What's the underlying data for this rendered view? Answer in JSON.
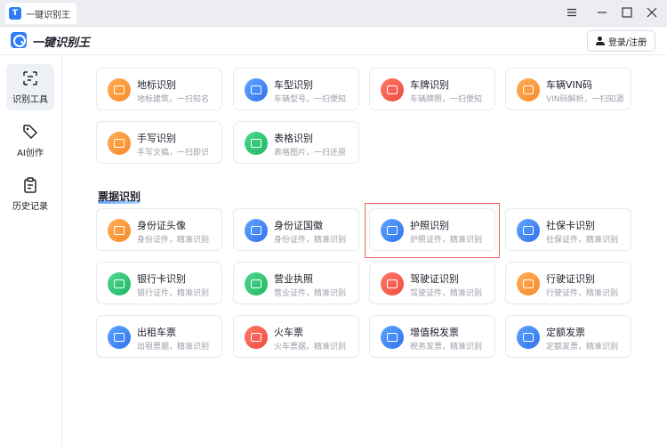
{
  "window": {
    "tab_title": "一键识别王",
    "logo_letter": "T"
  },
  "header": {
    "app_title": "一键识别王",
    "login_label": "登录/注册"
  },
  "sidebar": {
    "items": [
      {
        "label": "识别工具",
        "icon": "scan-icon",
        "active": true
      },
      {
        "label": "AI创作",
        "icon": "tag-icon",
        "active": false
      },
      {
        "label": "历史记录",
        "icon": "clipboard-icon",
        "active": false
      }
    ]
  },
  "general": {
    "cards": [
      {
        "title": "地标识别",
        "subtitle": "地标建筑，一扫知名",
        "color": "orange",
        "icon": "landmark-icon"
      },
      {
        "title": "车型识别",
        "subtitle": "车辆型号，一扫便知",
        "color": "blue",
        "icon": "car-icon"
      },
      {
        "title": "车牌识别",
        "subtitle": "车辆牌照，一扫便知",
        "color": "red",
        "icon": "license-plate-icon"
      },
      {
        "title": "车辆VIN码",
        "subtitle": "VIN码解析，一扫知源",
        "color": "orange",
        "icon": "vin-icon"
      },
      {
        "title": "手写识别",
        "subtitle": "手写文稿，一扫即识",
        "color": "orange",
        "icon": "handwriting-icon"
      },
      {
        "title": "表格识别",
        "subtitle": "表格图片，一扫还原",
        "color": "green",
        "icon": "table-icon"
      }
    ]
  },
  "bills": {
    "section_title": "票据识别",
    "cards": [
      {
        "title": "身份证头像",
        "subtitle": "身份证件，精准识别",
        "color": "orange",
        "icon": "id-card-front-icon"
      },
      {
        "title": "身份证国徽",
        "subtitle": "身份证件，精准识别",
        "color": "blue",
        "icon": "id-card-back-icon"
      },
      {
        "title": "护照识别",
        "subtitle": "护照证件，精准识别",
        "color": "blue",
        "icon": "passport-icon"
      },
      {
        "title": "社保卡识别",
        "subtitle": "社保证件，精准识别",
        "color": "blue",
        "icon": "social-security-card-icon"
      },
      {
        "title": "银行卡识别",
        "subtitle": "银行证件，精准识别",
        "color": "green",
        "icon": "bank-card-icon"
      },
      {
        "title": "营业执照",
        "subtitle": "营业证件，精准识别",
        "color": "green",
        "icon": "business-license-icon"
      },
      {
        "title": "驾驶证识别",
        "subtitle": "驾驶证件，精准识别",
        "color": "red",
        "icon": "driver-license-icon"
      },
      {
        "title": "行驶证识别",
        "subtitle": "行驶证件，精准识别",
        "color": "orange",
        "icon": "vehicle-license-icon"
      },
      {
        "title": "出租车票",
        "subtitle": "出租票据，精准识别",
        "color": "blue",
        "icon": "taxi-icon"
      },
      {
        "title": "火车票",
        "subtitle": "火车票据，精准识别",
        "color": "red",
        "icon": "train-icon"
      },
      {
        "title": "增值税发票",
        "subtitle": "税务发票，精准识别",
        "color": "blue",
        "icon": "vat-invoice-icon"
      },
      {
        "title": "定额发票",
        "subtitle": "定额发票，精准识别",
        "color": "blue",
        "icon": "quota-invoice-icon"
      }
    ]
  },
  "colors": {
    "accent": "#2f7cf6",
    "highlight_border": "#e9645a"
  }
}
